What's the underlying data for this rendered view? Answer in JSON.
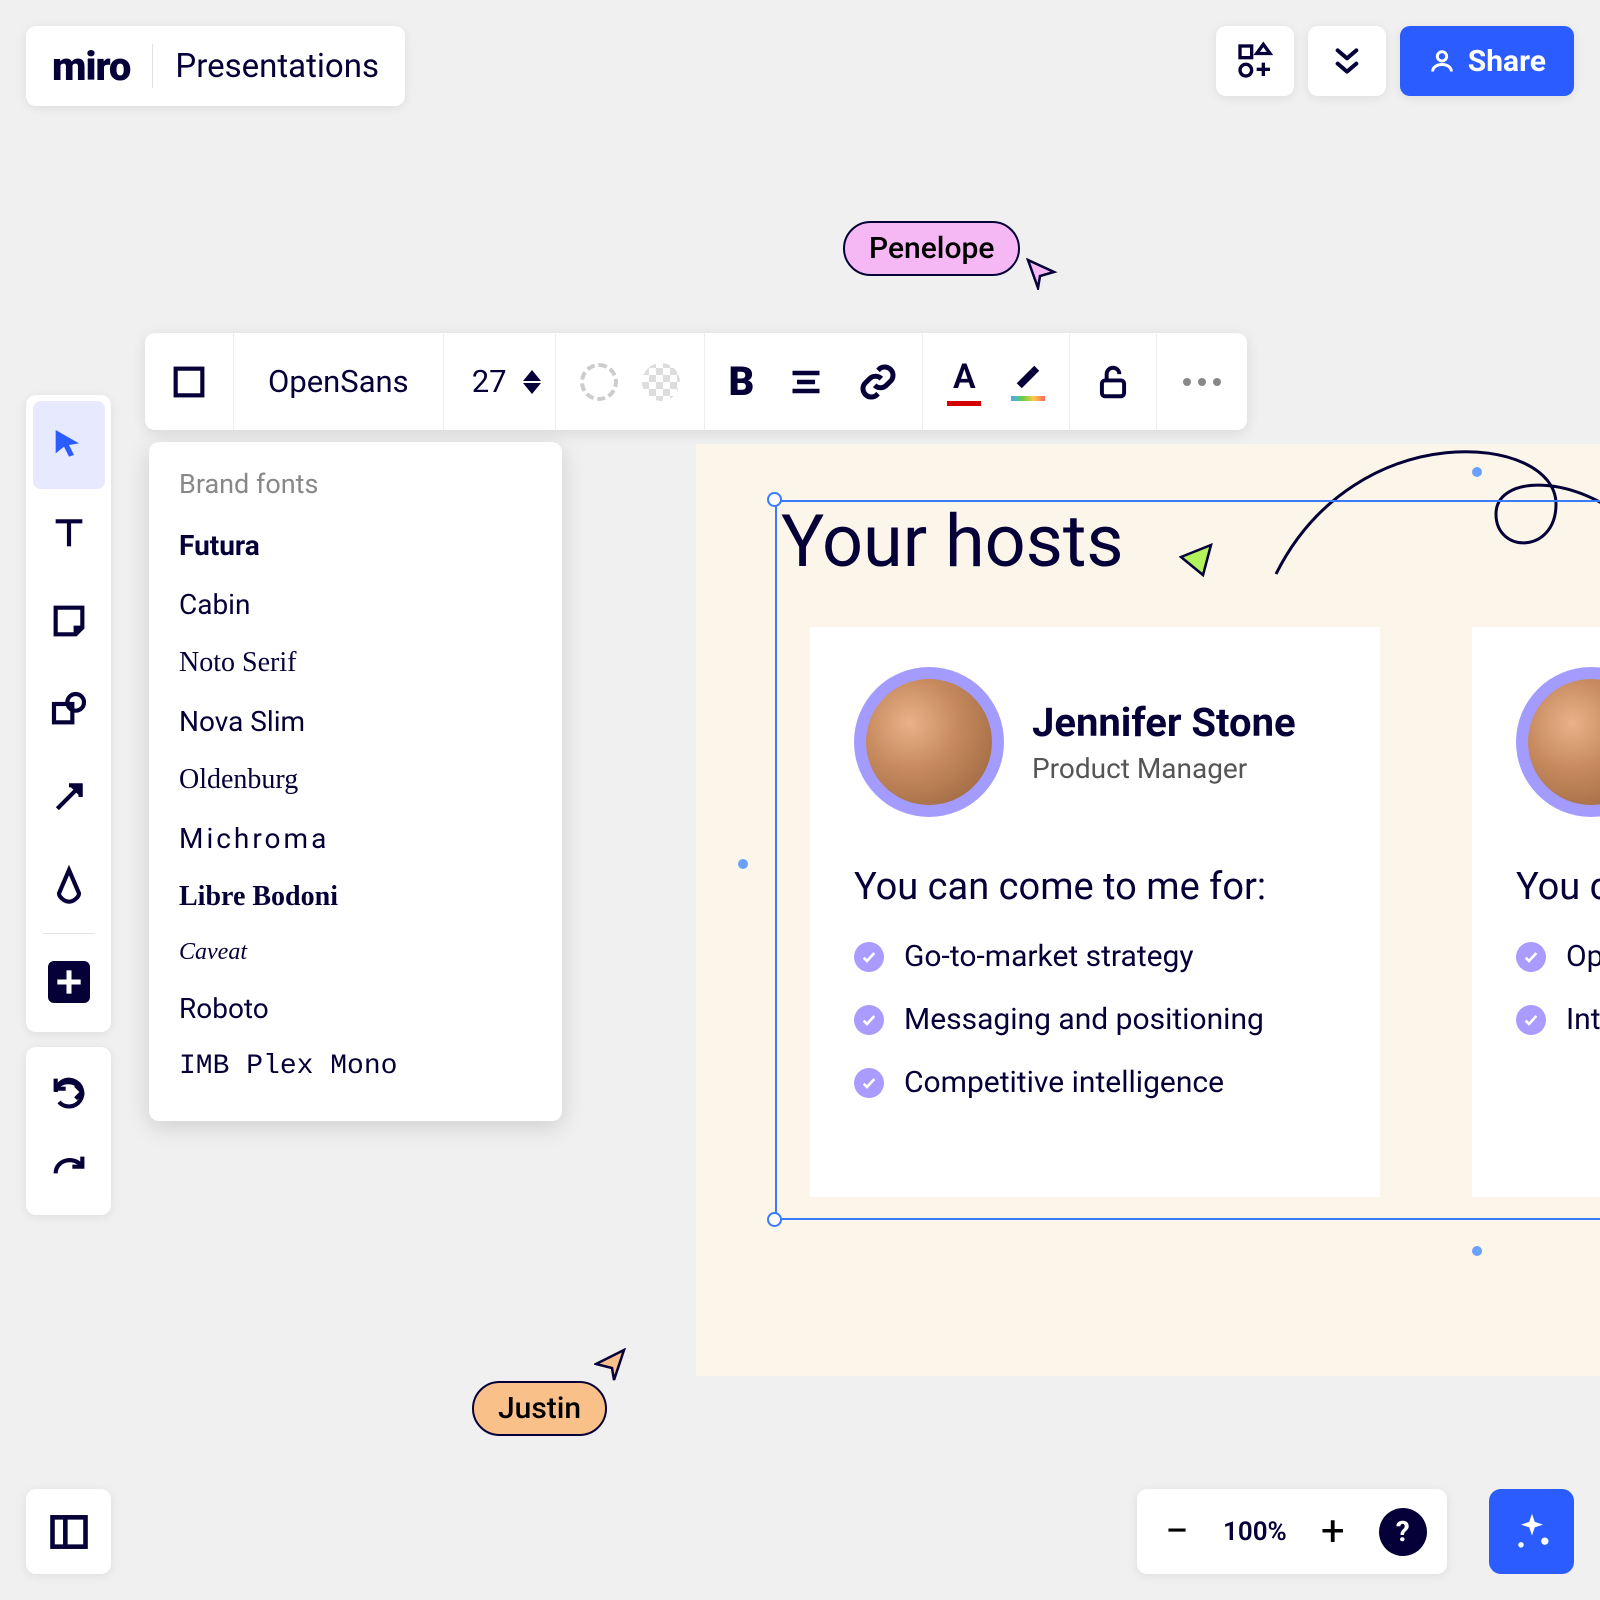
{
  "header": {
    "logo": "miro",
    "board_name": "Presentations",
    "share_label": "Share"
  },
  "context_toolbar": {
    "font_name": "OpenSans",
    "font_size": "27"
  },
  "font_dropdown": {
    "section_label": "Brand fonts",
    "fonts": [
      "Futura",
      "Cabin",
      "Noto Serif",
      "Nova Slim",
      "Oldenburg",
      "Michroma",
      "Libre Bodoni",
      "Caveat",
      "Roboto",
      "IMB Plex Mono"
    ]
  },
  "slide": {
    "title": "Your hosts",
    "card1": {
      "name": "Jennifer Stone",
      "role": "Product Manager",
      "subtitle": "You can come to me for:",
      "bullets": [
        "Go-to-market strategy",
        "Messaging and positioning",
        "Competitive intelligence"
      ]
    },
    "card2": {
      "subtitle_partial": "You c",
      "bullets_partial": [
        "Op",
        "Int"
      ]
    }
  },
  "cursors": {
    "penelope": "Penelope",
    "justin": "Justin"
  },
  "zoom": {
    "percent": "100%",
    "help": "?"
  }
}
